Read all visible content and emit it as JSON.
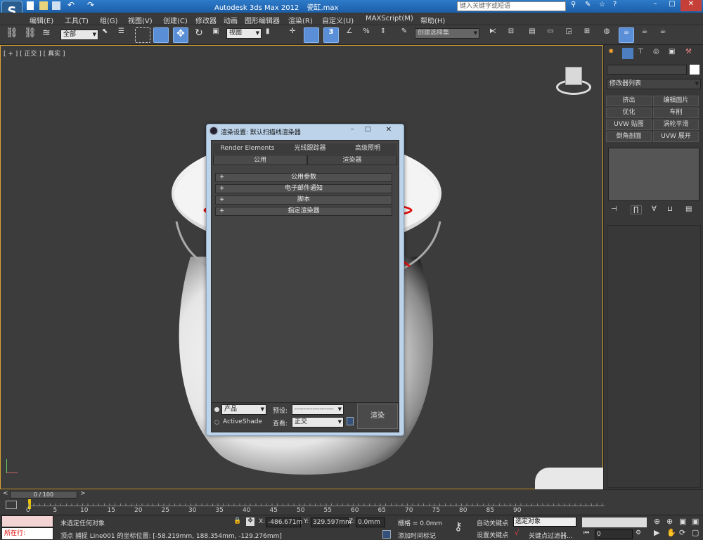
{
  "titlebar": {
    "app_title": "Autodesk 3ds Max 2012",
    "file_name": "瓷缸.max",
    "search_placeholder": "键入关键字或短语"
  },
  "menu": [
    "编辑(E)",
    "工具(T)",
    "组(G)",
    "视图(V)",
    "创建(C)",
    "修改器",
    "动画",
    "图形编辑器",
    "渲染(R)",
    "自定义(U)",
    "MAXScript(M)",
    "帮助(H)"
  ],
  "toolbar": {
    "selection_filter": "全部",
    "ref_coord": "视图",
    "named_selection": "创建选择集"
  },
  "viewport": {
    "label": "[ + ] [ 正交 ] [ 真实 ]"
  },
  "dialog": {
    "title": "渲染设置: 默认扫描线渲染器",
    "tabs_row1": [
      "Render Elements",
      "光线跟踪器",
      "高级照明"
    ],
    "tabs_row2": [
      "公用",
      "渲染器"
    ],
    "rollouts": [
      "公用参数",
      "电子邮件通知",
      "脚本",
      "指定渲染器"
    ],
    "mode_product": "产品",
    "mode_activeshade": "ActiveShade",
    "preset_label": "预设:",
    "preset_value": "----------------------",
    "view_label": "查看:",
    "view_value": "正交",
    "render_button": "渲染"
  },
  "command_panel": {
    "modifier_list": "修改器列表",
    "buttons": [
      "挤出",
      "编辑面片",
      "优化",
      "车削",
      "UVW 贴图",
      "涡轮平滑",
      "倒角剖面",
      "UVW 展开"
    ]
  },
  "timeline": {
    "frame": "0 / 100",
    "ticks": [
      "0",
      "5",
      "10",
      "15",
      "20",
      "25",
      "30",
      "35",
      "40",
      "45",
      "50",
      "55",
      "60",
      "65",
      "70",
      "75",
      "80",
      "85",
      "90"
    ]
  },
  "status": {
    "selection": "未选定任何对象",
    "prompt": "顶点 捕捉 Line001 的坐标位置: [-58.219mm, 188.354mm, -129.276mm]",
    "x_label": "X:",
    "x": "-486.671m",
    "y_label": "Y:",
    "y": "329.597mm",
    "z_label": "Z:",
    "z": "0.0mm",
    "grid": "栅格 = 0.0mm",
    "auto_key": "自动关键点",
    "set_key": "设置关键点",
    "selected_object": "选定对象",
    "key_filters": "关键点过滤器...",
    "add_time_tag": "添加时间标记",
    "frame_input": "0",
    "mini_listener": "所在行:",
    "colors": {
      "accent": "#5a8fd8",
      "annotation": "#e01010",
      "viewport_border": "#d9a533"
    }
  }
}
